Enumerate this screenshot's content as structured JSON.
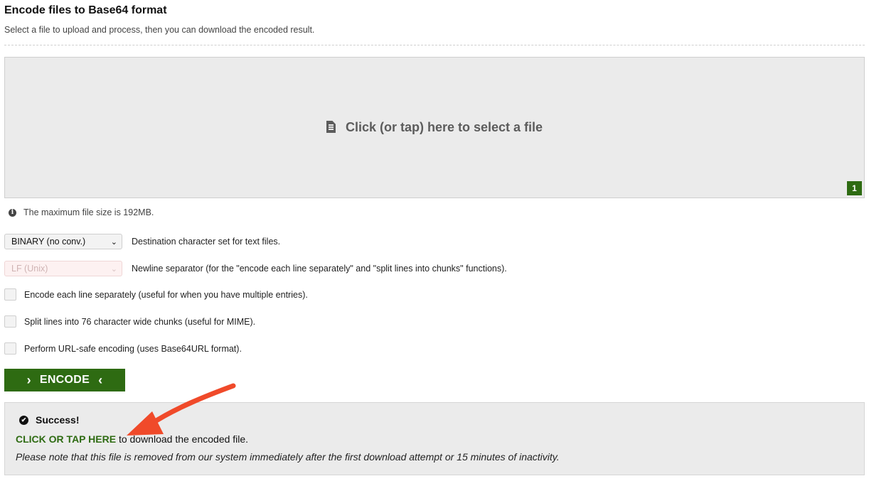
{
  "header": {
    "title": "Encode files to Base64 format",
    "subtitle": "Select a file to upload and process, then you can download the encoded result."
  },
  "dropzone": {
    "label": "Click (or tap) here to select a file",
    "icon": "file-icon",
    "badge": "1"
  },
  "limits": {
    "max_size_text": "The maximum file size is 192MB.",
    "icon": "info-icon"
  },
  "options": {
    "charset_select": {
      "value": "BINARY (no conv.)",
      "description": "Destination character set for text files."
    },
    "newline_select": {
      "value": "LF (Unix)",
      "description": "Newline separator (for the \"encode each line separately\" and \"split lines into chunks\" functions).",
      "disabled": true
    },
    "checkboxes": [
      {
        "label": "Encode each line separately (useful for when you have multiple entries).",
        "checked": false
      },
      {
        "label": "Split lines into 76 character wide chunks (useful for MIME).",
        "checked": false
      },
      {
        "label": "Perform URL-safe encoding (uses Base64URL format).",
        "checked": false
      }
    ]
  },
  "encode_button": {
    "label": "ENCODE",
    "left_arrow": "›",
    "right_arrow": "‹"
  },
  "result": {
    "success_label": "Success!",
    "download_link": "CLICK OR TAP HERE",
    "download_suffix": "to download the encoded file.",
    "note": "Please note that this file is removed from our system immediately after the first download attempt or 15 minutes of inactivity."
  },
  "colors": {
    "accent_green": "#2e6b12",
    "annotation_arrow": "#f04a2a"
  }
}
